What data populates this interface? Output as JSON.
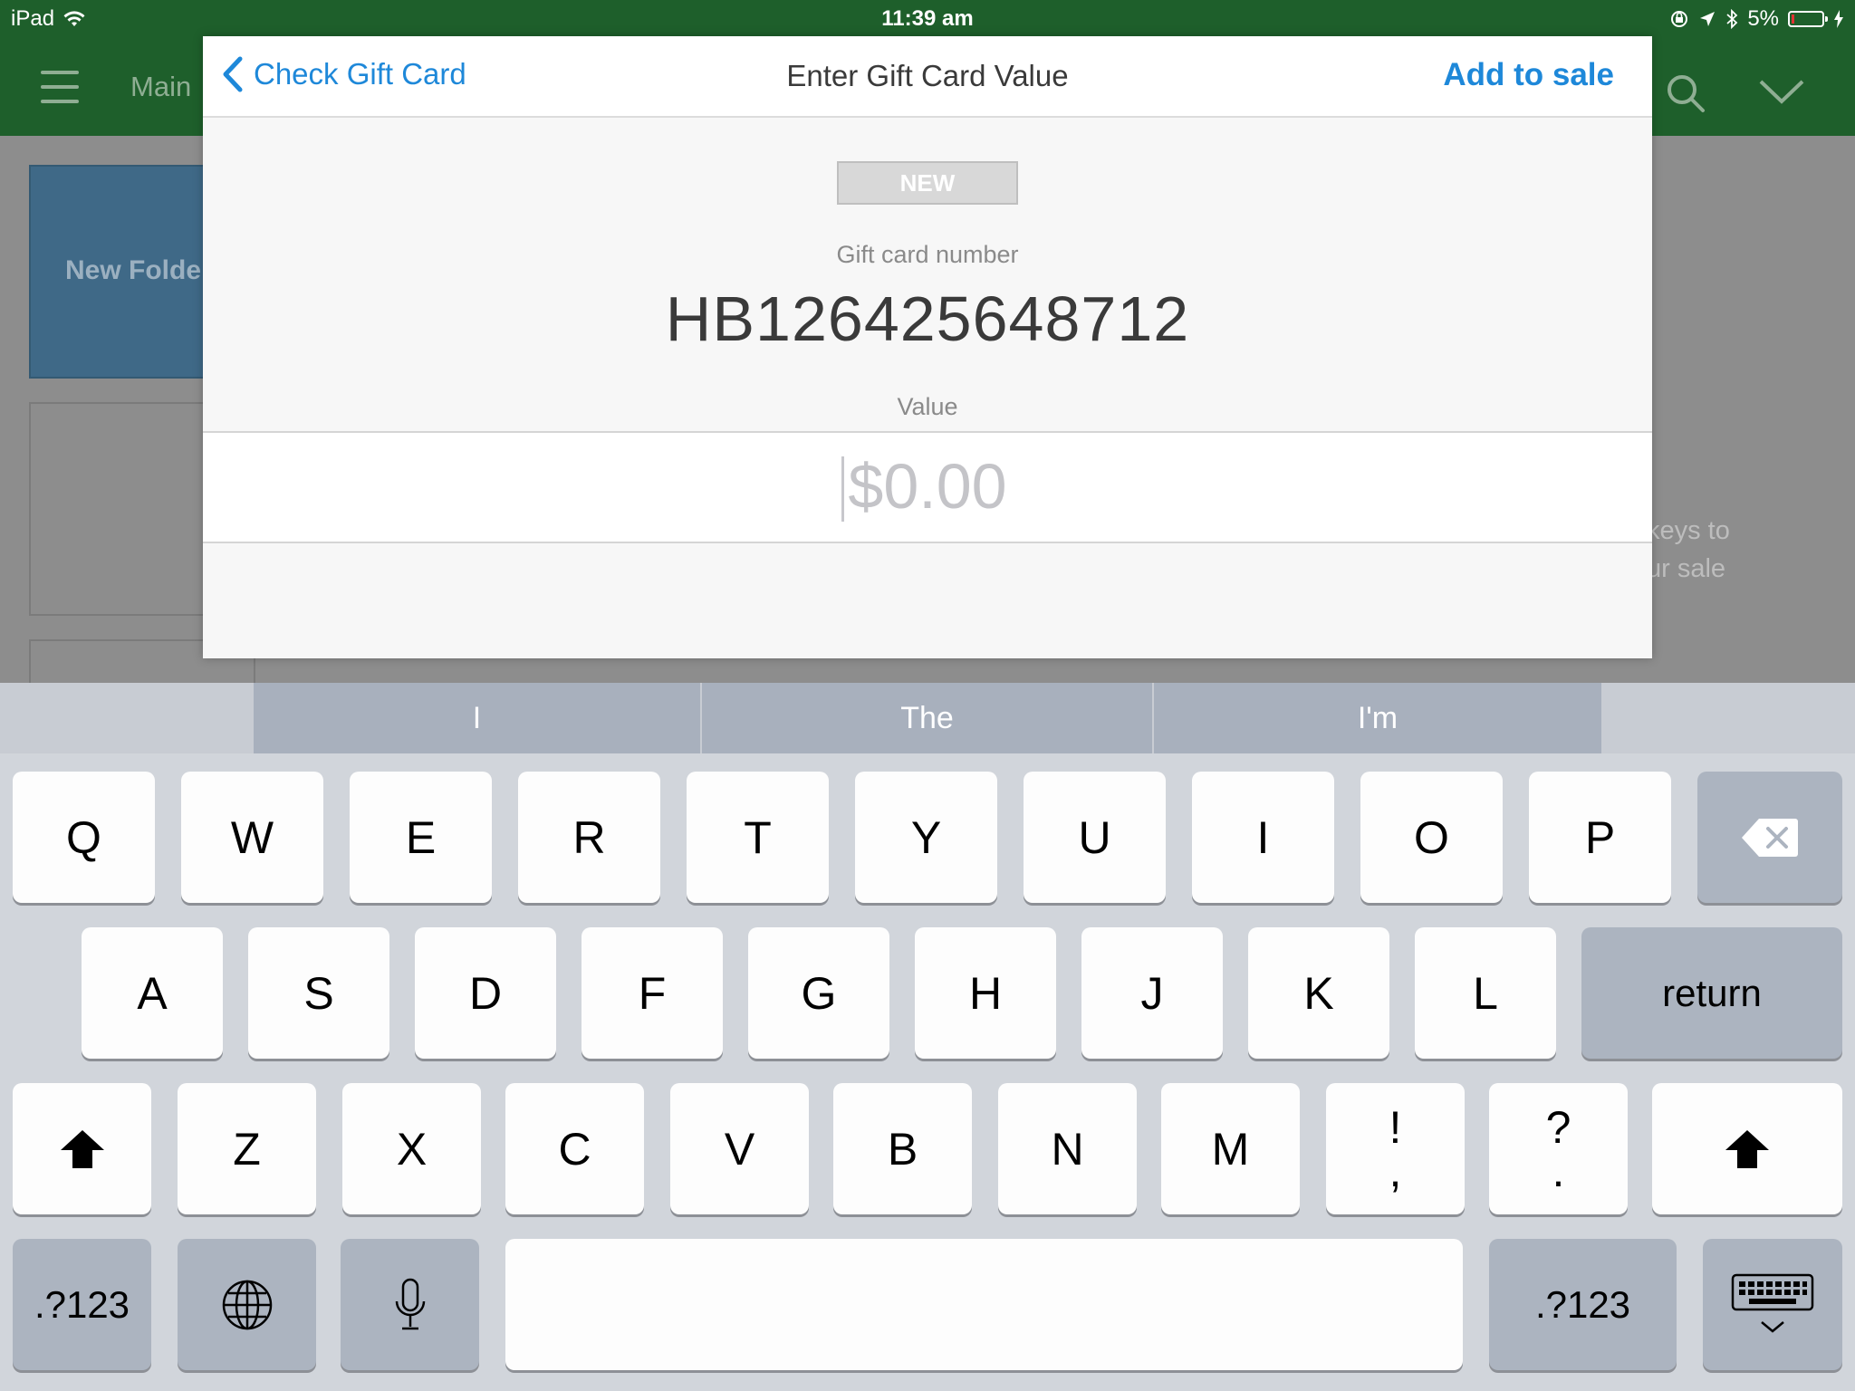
{
  "status_bar": {
    "device": "iPad",
    "time": "11:39 am",
    "battery": "5%"
  },
  "app_header": {
    "main_label": "Main"
  },
  "background": {
    "folder_tile": "New Folde",
    "hint_line1": "keys to",
    "hint_line2": "ur sale"
  },
  "modal": {
    "back_label": "Check Gift Card",
    "title": "Enter Gift Card Value",
    "add_label": "Add to sale",
    "badge": "NEW",
    "gift_card_label": "Gift card number",
    "gift_card_number": "HB126425648712",
    "value_label": "Value",
    "value_placeholder": "$0.00"
  },
  "keyboard": {
    "suggestions": [
      "I",
      "The",
      "I'm"
    ],
    "row1": [
      "Q",
      "W",
      "E",
      "R",
      "T",
      "Y",
      "U",
      "I",
      "O",
      "P"
    ],
    "row2": [
      "A",
      "S",
      "D",
      "F",
      "G",
      "H",
      "J",
      "K",
      "L"
    ],
    "return_label": "return",
    "row3": [
      "Z",
      "X",
      "C",
      "V",
      "B",
      "N",
      "M"
    ],
    "punct1_top": "!",
    "punct1_bottom": ",",
    "punct2_top": "?",
    "punct2_bottom": ".",
    "numbers_label": ".?123",
    "icons": {
      "backspace": "backspace-icon",
      "shift": "shift-icon",
      "globe": "globe-icon",
      "mic": "microphone-icon",
      "dismiss": "keyboard-dismiss-icon"
    }
  },
  "colors": {
    "header_green": "#1e5f2b",
    "accent_blue": "#1e88d9",
    "folder_blue": "#3f6987",
    "keyboard_bg": "#d1d5db"
  }
}
